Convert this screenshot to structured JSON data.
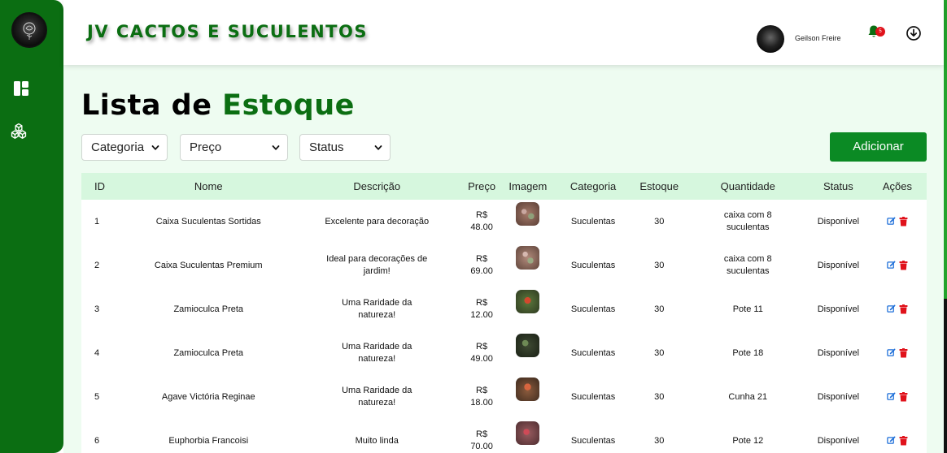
{
  "brand": {
    "title": "JV CACTOS E SUCULENTOS"
  },
  "user": {
    "name": "Geilson Freire",
    "notification_count": "5"
  },
  "page": {
    "title_part1": "Lista de",
    "title_part2": "Estoque"
  },
  "filters": {
    "categoria": "Categoria",
    "preco": "Preço",
    "status": "Status"
  },
  "add_button": "Adicionar",
  "table": {
    "headers": [
      "ID",
      "Nome",
      "Descrição",
      "Preço",
      "Imagem",
      "Categoria",
      "Estoque",
      "Quantidade",
      "Status",
      "Ações"
    ],
    "rows": [
      {
        "id": "1",
        "nome": "Caixa Suculentas Sortidas",
        "descricao": "Excelente para decoração",
        "preco_prefix": "R$",
        "preco_value": "48.00",
        "categoria": "Suculentas",
        "estoque": "30",
        "quantidade": "caixa com 8 suculentas",
        "status": "Disponível"
      },
      {
        "id": "2",
        "nome": "Caixa Suculentas Premium",
        "descricao": "Ideal para decorações de jardim!",
        "preco_prefix": "R$",
        "preco_value": "69.00",
        "categoria": "Suculentas",
        "estoque": "30",
        "quantidade": "caixa com 8 suculentas",
        "status": "Disponível"
      },
      {
        "id": "3",
        "nome": "Zamioculca Preta",
        "descricao": "Uma Raridade da natureza!",
        "preco_prefix": "R$",
        "preco_value": "12.00",
        "categoria": "Suculentas",
        "estoque": "30",
        "quantidade": "Pote 11",
        "status": "Disponível"
      },
      {
        "id": "4",
        "nome": "Zamioculca Preta",
        "descricao": "Uma Raridade da natureza!",
        "preco_prefix": "R$",
        "preco_value": "49.00",
        "categoria": "Suculentas",
        "estoque": "30",
        "quantidade": "Pote 18",
        "status": "Disponível"
      },
      {
        "id": "5",
        "nome": "Agave Victória Reginae",
        "descricao": "Uma Raridade da natureza!",
        "preco_prefix": "R$",
        "preco_value": "18.00",
        "categoria": "Suculentas",
        "estoque": "30",
        "quantidade": "Cunha 21",
        "status": "Disponível"
      },
      {
        "id": "6",
        "nome": "Euphorbia Francoisi",
        "descricao": "Muito linda",
        "preco_prefix": "R$",
        "preco_value": "70.00",
        "categoria": "Suculentas",
        "estoque": "30",
        "quantidade": "Pote 12",
        "status": "Disponível"
      }
    ]
  },
  "colors": {
    "primary": "#0b6e12",
    "button": "#0b8a24",
    "header_row": "#d6f7de",
    "background": "#eefcf1",
    "delete": "#e0121b",
    "edit": "#1e6fd9"
  },
  "icons": {
    "dashboard": "dashboard-icon",
    "products": "cubes-icon",
    "notifications": "bell-icon",
    "download": "download-circle-icon",
    "edit": "edit-icon",
    "delete": "trash-icon"
  }
}
